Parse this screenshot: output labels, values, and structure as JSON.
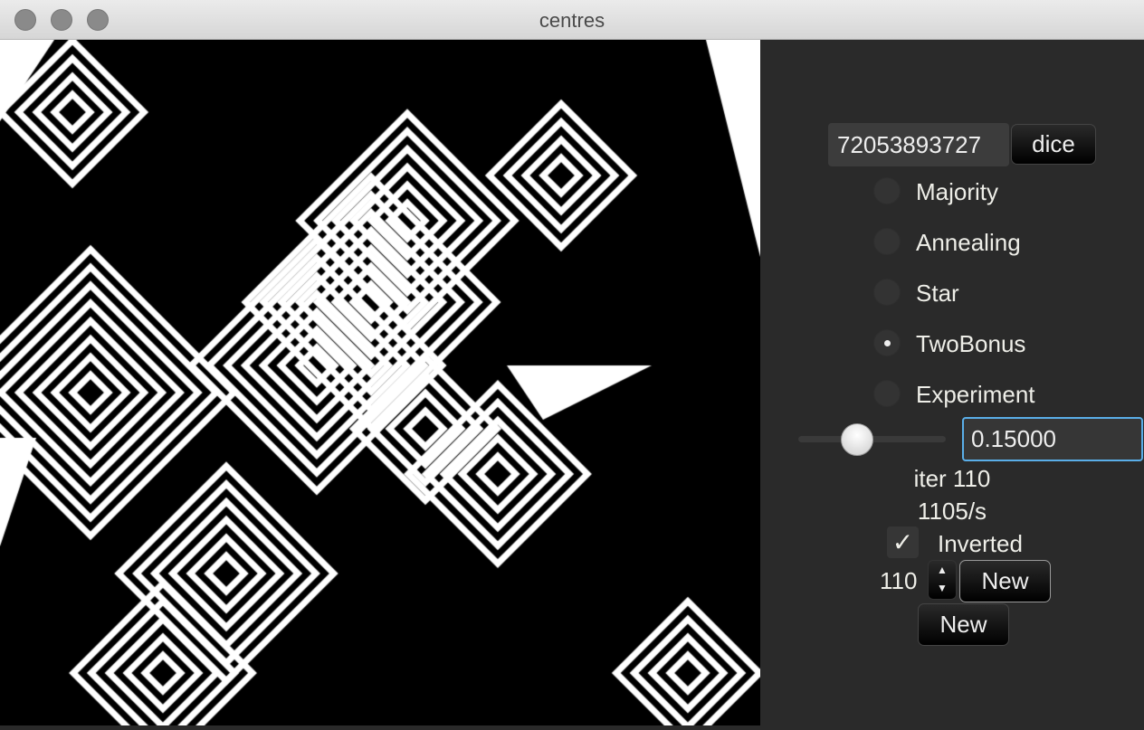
{
  "window": {
    "title": "centres"
  },
  "controls": {
    "seed_value": "72053893727",
    "dice_label": "dice",
    "modes": [
      {
        "label": "Majority",
        "selected": false
      },
      {
        "label": "Annealing",
        "selected": false
      },
      {
        "label": "Star",
        "selected": false
      },
      {
        "label": "TwoBonus",
        "selected": true
      },
      {
        "label": "Experiment",
        "selected": false
      }
    ],
    "slider_value": 0.15,
    "slider_text": "0.15000",
    "iter_text": "iter 110",
    "rate_text": "1105/s",
    "inverted_label": "Inverted",
    "inverted_checked": true,
    "stepper_value": "110",
    "new_label_1": "New",
    "new_label_2": "New"
  }
}
